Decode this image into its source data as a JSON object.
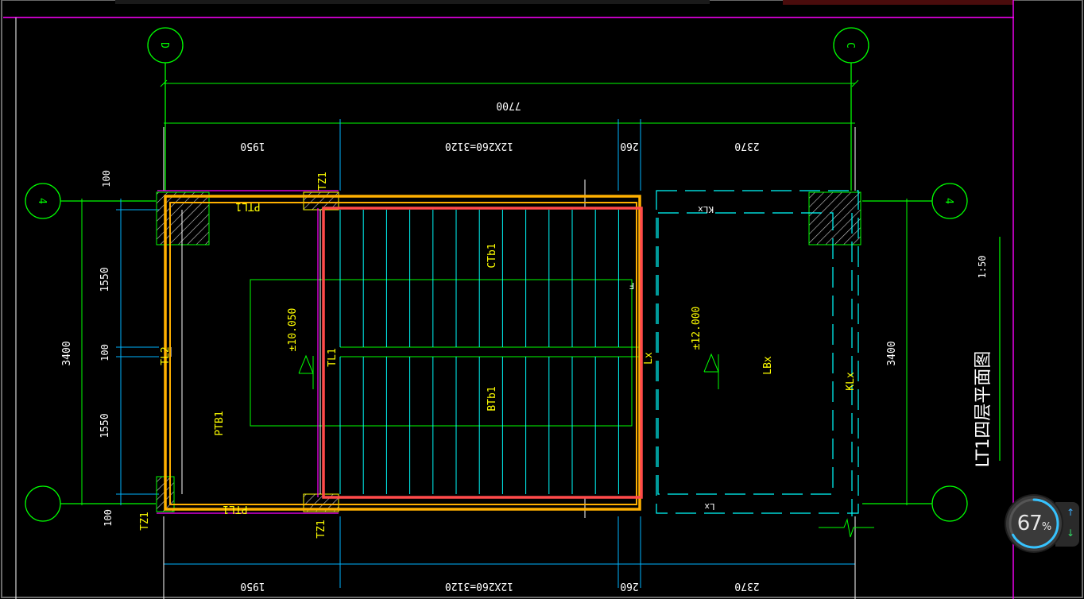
{
  "drawing": {
    "title": "LT1四层平面图",
    "scale": "1:50",
    "axis_labels": {
      "top_left": "D",
      "top_right": "C",
      "mid_left": "4",
      "mid_right": "4"
    },
    "dimensions": {
      "overall_top": "7700",
      "seg_1": "1950",
      "seg_2": "12X260=3120",
      "seg_3": "260",
      "seg_4": "2370",
      "seg_1_bottom": "1950",
      "seg_2_bottom": "12X260=3120",
      "seg_3_bottom": "260",
      "seg_4_bottom": "2370",
      "left_overall": "3400",
      "left_1": "100",
      "left_2": "1550",
      "left_3": "100",
      "left_4": "1550",
      "left_5": "100",
      "right_overall": "3400"
    },
    "labels": {
      "tz1_top": "TZ1",
      "tz1_bottom_left": "TZ1",
      "tz1_bottom_mid": "TZ1",
      "ptl1_top": "PTL1",
      "ptl1_bottom": "PTL1",
      "tl2": "TL2",
      "tl1": "TL1",
      "ptb1": "PTB1",
      "ctb1": "CTb1",
      "btb1": "BTb1",
      "elev_1": "±10.050",
      "elev_2": "±12.000",
      "lbx": "LBx",
      "klx_top": "KLx",
      "klx_right": "KLx",
      "lx_mid": "Lx",
      "lx_bottom": "Lx",
      "f_mark": "F"
    }
  },
  "zoom": {
    "value": "67",
    "unit": "%"
  },
  "colors": {
    "background": "#000000",
    "green": "#00ff00",
    "yellow": "#ffff00",
    "cyan": "#00ffff",
    "orange": "#ffb000",
    "red": "#ff4040",
    "magenta": "#ff00ff",
    "white": "#ffffff",
    "hatch": "#c8c8c8"
  }
}
